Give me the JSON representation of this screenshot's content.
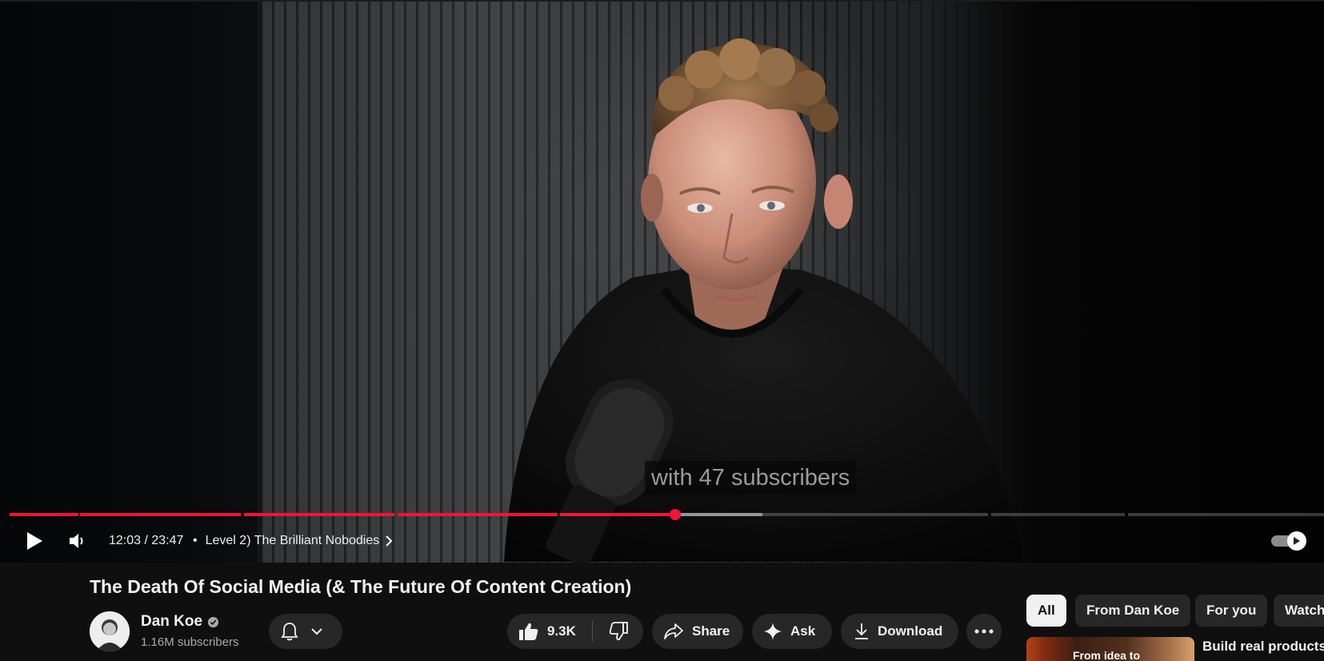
{
  "player": {
    "caption": "with 47 subscribers",
    "time": "12:03 / 23:47",
    "chapter_separator": "•",
    "chapter": "Level 2) The Brilliant Nobodies",
    "progress_fraction": 0.5066,
    "buffered_fraction": 0.5725,
    "accent_color": "#f1133a"
  },
  "video": {
    "title": "The Death Of Social Media (& The Future Of Content Creation)"
  },
  "channel": {
    "name": "Dan Koe",
    "verified": true,
    "subscribers": "1.16M subscribers"
  },
  "actions": {
    "like_count": "9.3K",
    "share_label": "Share",
    "ask_label": "Ask",
    "download_label": "Download"
  },
  "chips": [
    {
      "label": "All",
      "active": true
    },
    {
      "label": "From Dan Koe",
      "active": false
    },
    {
      "label": "For you",
      "active": false
    },
    {
      "label": "Watch",
      "active": false
    }
  ],
  "recommendation": {
    "thumbnail_text": "From idea to",
    "title": "Build real products"
  },
  "icons": {
    "play": "play-icon",
    "volume": "volume-icon",
    "autoplay": "autoplay-toggle-icon",
    "bell": "bell-icon",
    "like": "thumbs-up-icon",
    "dislike": "thumbs-down-icon",
    "share": "share-icon",
    "ask": "sparkle-icon",
    "download": "download-icon",
    "more": "more-icon"
  }
}
